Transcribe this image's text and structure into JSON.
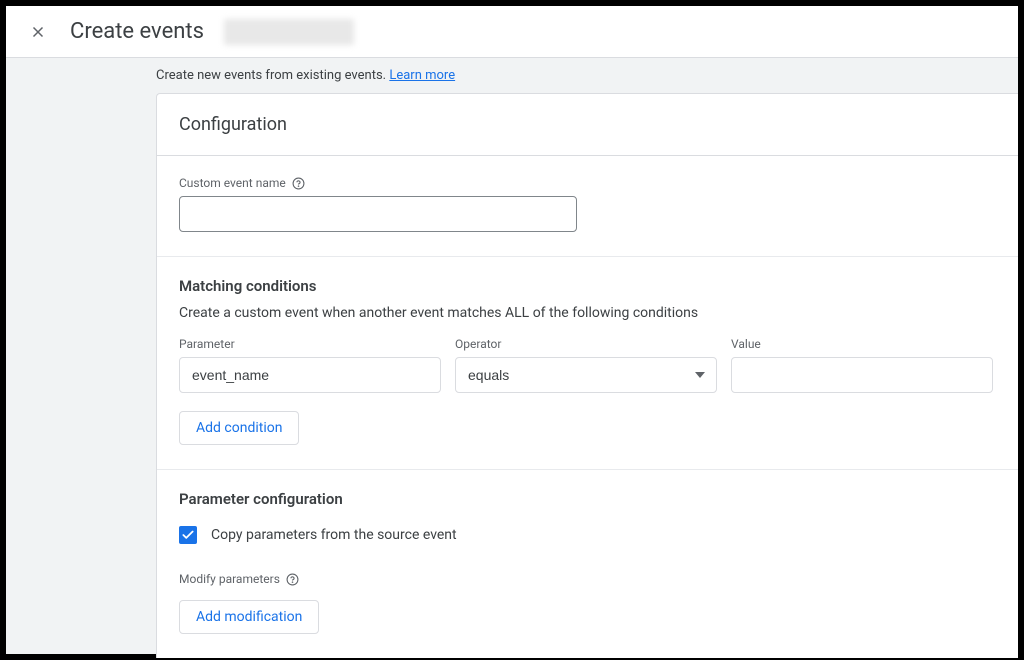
{
  "header": {
    "title": "Create events"
  },
  "subheader": {
    "text": "Create new events from existing events. ",
    "link": "Learn more"
  },
  "panel": {
    "title": "Configuration"
  },
  "custom_event": {
    "label": "Custom event name",
    "value": ""
  },
  "matching": {
    "title": "Matching conditions",
    "desc": "Create a custom event when another event matches ALL of the following conditions",
    "param_label": "Parameter",
    "param_value": "event_name",
    "op_label": "Operator",
    "op_value": "equals",
    "val_label": "Value",
    "val_value": "",
    "add_condition": "Add condition"
  },
  "param_config": {
    "title": "Parameter configuration",
    "copy_label": "Copy parameters from the source event",
    "modify_label": "Modify parameters",
    "add_modification": "Add modification"
  }
}
